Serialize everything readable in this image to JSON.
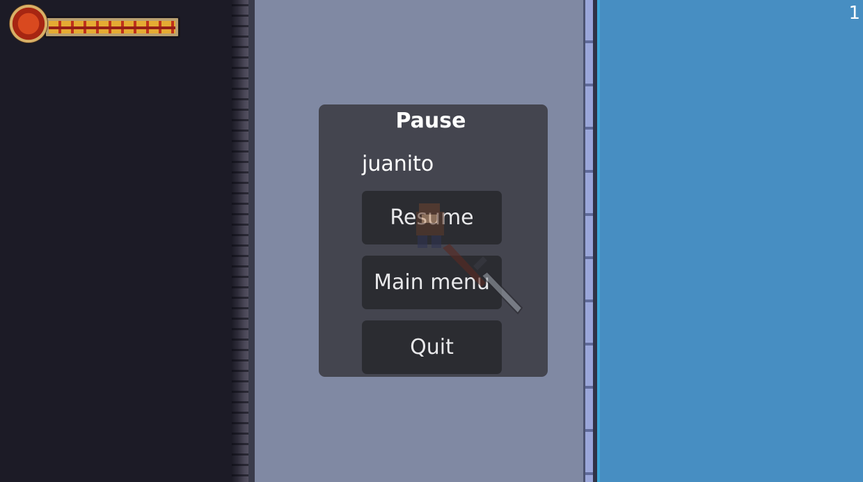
{
  "hud": {
    "health_level": 1.0,
    "counter": "1"
  },
  "pause_menu": {
    "title": "Pause",
    "player_name": "juanito",
    "buttons": {
      "resume": "Resume",
      "main_menu": "Main menu",
      "quit": "Quit"
    }
  },
  "colors": {
    "void": "#1c1b26",
    "floor": "#8089a3",
    "water": "#478ec2",
    "panel": "#44454f",
    "button": "#2b2c31"
  },
  "icons": [
    "health-orb-icon",
    "character-sprite"
  ]
}
